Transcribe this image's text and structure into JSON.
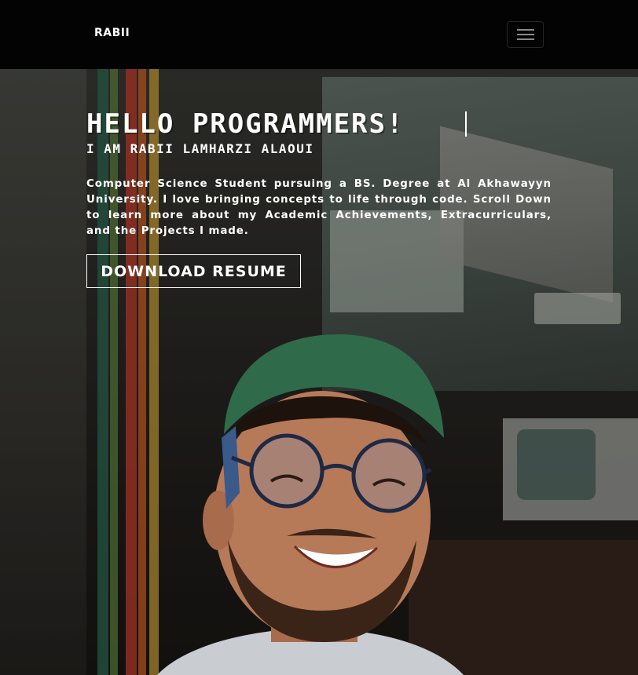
{
  "navbar": {
    "brand": "RABII",
    "menu_icon": "hamburger-menu-icon"
  },
  "hero": {
    "headline": "HELLO PROGRAMMERS!",
    "subheadline": "I AM RABII LAMHARZI ALAOUI",
    "bio": "Computer Science Student pursuing a BS. Degree at Al Akhawayyn University. I love bringing concepts to life through code. Scroll Down to learn more about my Academic Achievements, Extracurriculars, and the Projects I made.",
    "resume_button": "DOWNLOAD RESUME",
    "background_image": "retro-computer-store-portrait-photo"
  },
  "colors": {
    "navbar_bg": "#030303",
    "text": "#ffffff",
    "cap_green": "#2f6b4a",
    "stripe_colors": [
      "#2f6f55",
      "#6a8f46",
      "#c9412e",
      "#d9672c",
      "#e3b23c"
    ]
  }
}
